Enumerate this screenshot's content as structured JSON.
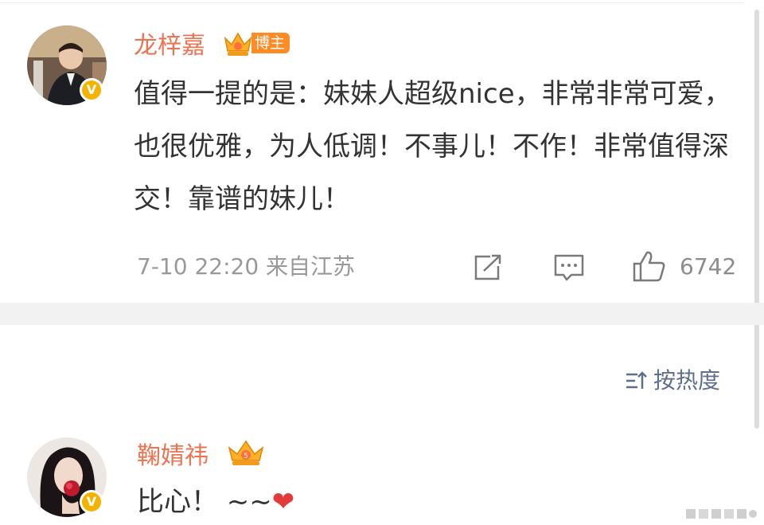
{
  "main_comment": {
    "username": "龙梓嘉",
    "tag": "博主",
    "text": "值得一提的是：妹妹人超级nice，非常非常可爱，也很优雅，为人低调！不事儿！不作！非常值得深交！靠谱的妹儿！",
    "meta": "7-10 22:20 来自江苏",
    "likes": "6742",
    "icons": [
      "repost-icon",
      "comment-icon",
      "like-icon"
    ]
  },
  "sort": {
    "label": "按热度",
    "icon": "sort-icon"
  },
  "reply": {
    "username": "鞠婧祎",
    "text": "比心！ ~~",
    "emoji": "❤"
  },
  "colors": {
    "username": "#eb7350",
    "accent": "#ff8b25",
    "verified": "#f5b300",
    "sort": "#5f6f8a"
  }
}
